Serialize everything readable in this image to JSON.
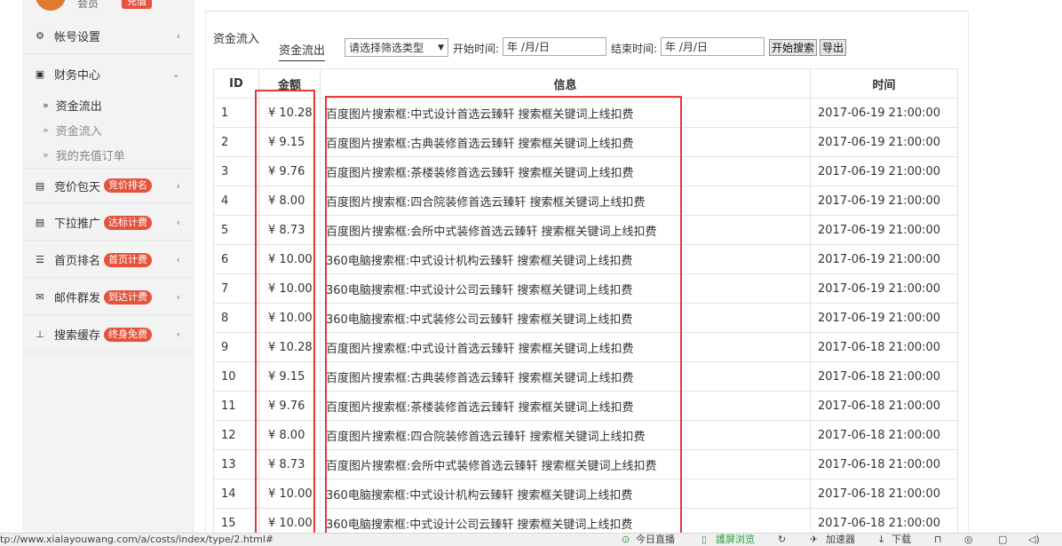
{
  "sidebar": {
    "user_name": "会员",
    "recharge_label": "充值",
    "items": [
      {
        "icon": "gear-icon",
        "label": "帐号设置"
      },
      {
        "icon": "money-icon",
        "label": "财务中心"
      },
      {
        "icon": "list-card-icon",
        "label": "竞价包天",
        "badge": "竞价排名"
      },
      {
        "icon": "list-card-icon",
        "label": "下拉推广",
        "badge": "达标计费"
      },
      {
        "icon": "list-icon",
        "label": "首页排名",
        "badge": "首页计费"
      },
      {
        "icon": "envelope-icon",
        "label": "邮件群发",
        "badge": "到达计费"
      },
      {
        "icon": "pin-icon",
        "label": "搜索缓存",
        "badge": "终身免费"
      }
    ],
    "finance_sub": [
      "资金流出",
      "资金流入",
      "我的充值订单"
    ]
  },
  "toolbar": {
    "tab_in": "资金流入",
    "tab_out": "资金流出",
    "filter_select": "请选择筛选类型",
    "start_label": "开始时间:",
    "start_placeholder": "年 /月/日",
    "end_label": "结束时间:",
    "end_placeholder": "年 /月/日",
    "search_button": "开始搜索",
    "export_button": "导出"
  },
  "table": {
    "headers": [
      "ID",
      "金额",
      "信息",
      "时间"
    ],
    "rows": [
      {
        "id": "1",
        "amount": "¥ 10.28",
        "info": "百度图片搜索框:中式设计首选云臻轩 搜索框关键词上线扣费",
        "time": "2017-06-19 21:00:00"
      },
      {
        "id": "2",
        "amount": "¥ 9.15",
        "info": "百度图片搜索框:古典装修首选云臻轩 搜索框关键词上线扣费",
        "time": "2017-06-19 21:00:00"
      },
      {
        "id": "3",
        "amount": "¥ 9.76",
        "info": "百度图片搜索框:茶楼装修首选云臻轩 搜索框关键词上线扣费",
        "time": "2017-06-19 21:00:00"
      },
      {
        "id": "4",
        "amount": "¥ 8.00",
        "info": "百度图片搜索框:四合院装修首选云臻轩 搜索框关键词上线扣费",
        "time": "2017-06-19 21:00:00"
      },
      {
        "id": "5",
        "amount": "¥ 8.73",
        "info": "百度图片搜索框:会所中式装修首选云臻轩 搜索框关键词上线扣费",
        "time": "2017-06-19 21:00:00"
      },
      {
        "id": "6",
        "amount": "¥ 10.00",
        "info": "360电脑搜索框:中式设计机构云臻轩 搜索框关键词上线扣费",
        "time": "2017-06-19 21:00:00"
      },
      {
        "id": "7",
        "amount": "¥ 10.00",
        "info": "360电脑搜索框:中式设计公司云臻轩 搜索框关键词上线扣费",
        "time": "2017-06-19 21:00:00"
      },
      {
        "id": "8",
        "amount": "¥ 10.00",
        "info": "360电脑搜索框:中式装修公司云臻轩 搜索框关键词上线扣费",
        "time": "2017-06-19 21:00:00"
      },
      {
        "id": "9",
        "amount": "¥ 10.28",
        "info": "百度图片搜索框:中式设计首选云臻轩 搜索框关键词上线扣费",
        "time": "2017-06-18 21:00:00"
      },
      {
        "id": "10",
        "amount": "¥ 9.15",
        "info": "百度图片搜索框:古典装修首选云臻轩 搜索框关键词上线扣费",
        "time": "2017-06-18 21:00:00"
      },
      {
        "id": "11",
        "amount": "¥ 9.76",
        "info": "百度图片搜索框:茶楼装修首选云臻轩 搜索框关键词上线扣费",
        "time": "2017-06-18 21:00:00"
      },
      {
        "id": "12",
        "amount": "¥ 8.00",
        "info": "百度图片搜索框:四合院装修首选云臻轩 搜索框关键词上线扣费",
        "time": "2017-06-18 21:00:00"
      },
      {
        "id": "13",
        "amount": "¥ 8.73",
        "info": "百度图片搜索框:会所中式装修首选云臻轩 搜索框关键词上线扣费",
        "time": "2017-06-18 21:00:00"
      },
      {
        "id": "14",
        "amount": "¥ 10.00",
        "info": "360电脑搜索框:中式设计机构云臻轩 搜索框关键词上线扣费",
        "time": "2017-06-18 21:00:00"
      },
      {
        "id": "15",
        "amount": "¥ 10.00",
        "info": "360电脑搜索框:中式设计公司云臻轩 搜索框关键词上线扣费",
        "time": "2017-06-18 21:00:00"
      }
    ]
  },
  "statusbar": {
    "url": "tp://www.xialayouwang.com/a/costs/index/type/2.html#",
    "live": "今日直播",
    "screen": "護屏浏览",
    "accelerate": "加速器",
    "download": "下载"
  },
  "colors": {
    "highlight": "#e53935",
    "badge": "#e5533d",
    "sidebar_bg": "#f3f3f3"
  }
}
